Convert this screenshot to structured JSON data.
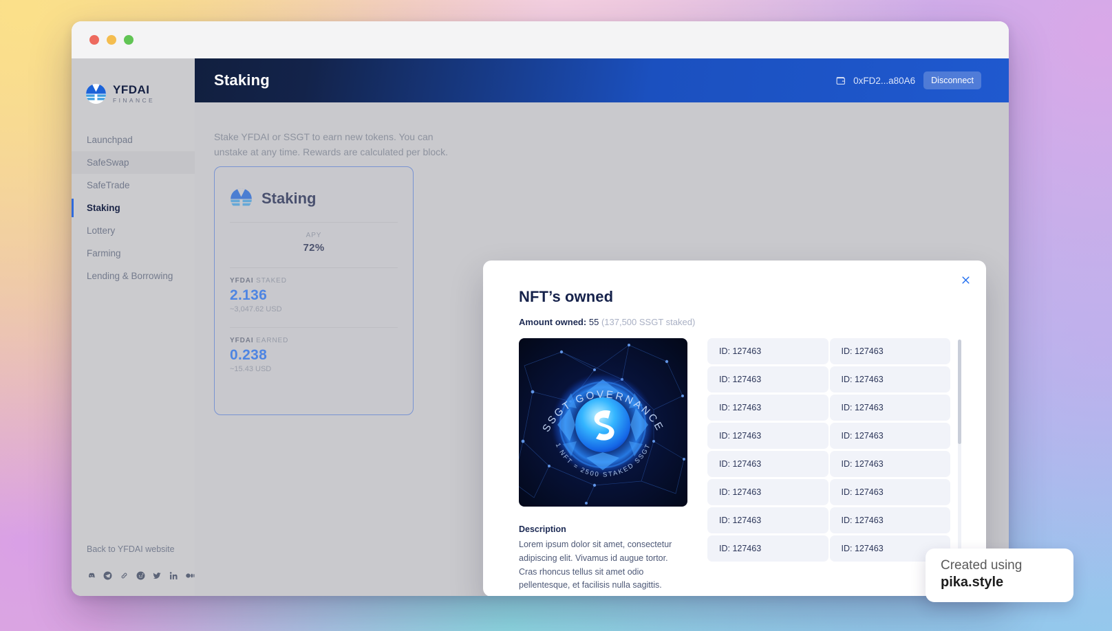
{
  "window": {
    "traffic_lights": [
      "close",
      "minimize",
      "zoom"
    ]
  },
  "sidebar": {
    "logo": {
      "title": "YFDAI",
      "subtitle": "FINANCE",
      "icon": "yfdai-logo-icon"
    },
    "items": [
      {
        "label": "Launchpad",
        "state": "default"
      },
      {
        "label": "SafeSwap",
        "state": "hover"
      },
      {
        "label": "SafeTrade",
        "state": "default"
      },
      {
        "label": "Staking",
        "state": "active"
      },
      {
        "label": "Lottery",
        "state": "default"
      },
      {
        "label": "Farming",
        "state": "default"
      },
      {
        "label": "Lending & Borrowing",
        "state": "default"
      }
    ],
    "footer": {
      "back_link": "Back to YFDAI website",
      "socials": [
        "discord-icon",
        "telegram-icon",
        "link-icon",
        "reddit-icon",
        "twitter-icon",
        "linkedin-icon",
        "medium-icon"
      ]
    }
  },
  "topbar": {
    "title": "Staking",
    "wallet_icon": "wallet-icon",
    "wallet_address": "0xFD2...a80A6",
    "disconnect_label": "Disconnect"
  },
  "content": {
    "intro": "Stake YFDAI or SSGT to earn new tokens. You can unstake at any time. Rewards are calculated per block."
  },
  "stake_card": {
    "icon": "yfdai-token-icon",
    "title": "Staking",
    "stats": [
      {
        "label": "APY",
        "label_bold": "",
        "value": "72%",
        "sub": ""
      },
      {
        "label": " STAKED",
        "label_bold": "YFDAI",
        "value": "2.136",
        "sub": "~3,047.62 USD"
      },
      {
        "label": " EARNED",
        "label_bold": "YFDAI",
        "value": "0.238",
        "sub": "~15.43 USD"
      }
    ]
  },
  "modal": {
    "title": "NFT’s owned",
    "close_icon": "close-icon",
    "amount_label": "Amount owned:",
    "amount_value": "55",
    "amount_note": "(137,500 SSGT staked)",
    "nft_art": {
      "top_arc_text": "SSGT GOVERNANCE",
      "bottom_arc_text": "1 NFT = 2500 STAKED SSGT",
      "alt": "ssgt-governance-nft-artwork"
    },
    "description_title": "Description",
    "description_body": "Lorem ipsum dolor sit amet, consectetur adipiscing elit. Vivamus id augue tortor. Cras rhoncus tellus sit amet odio pellentesque, et facilisis nulla sagittis.",
    "ids": [
      "ID: 127463",
      "ID: 127463",
      "ID: 127463",
      "ID: 127463",
      "ID: 127463",
      "ID: 127463",
      "ID: 127463",
      "ID: 127463",
      "ID: 127463",
      "ID: 127463",
      "ID: 127463",
      "ID: 127463",
      "ID: 127463",
      "ID: 127463",
      "ID: 127463",
      "ID: 127463"
    ]
  },
  "watermark": {
    "line1": "Created using",
    "line2": "pika.style"
  },
  "colors": {
    "accent_blue": "#1f6df0",
    "topbar_navy": "#111f3f",
    "topbar_blue": "#1f59cf",
    "sidebar_gray": "#cbcbce",
    "chip_gray": "#f1f3f9"
  }
}
